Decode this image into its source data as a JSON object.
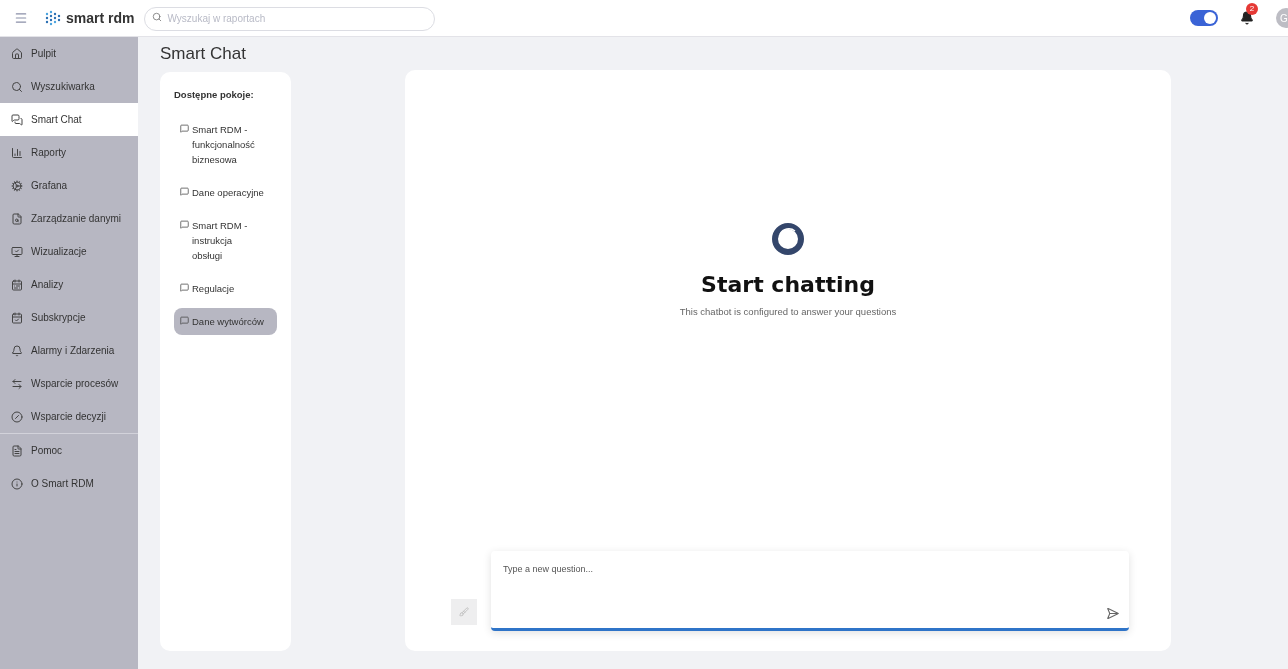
{
  "topbar": {
    "logo": "smart rdm",
    "search": {
      "placeholder": "Wyszukaj w raportach"
    },
    "theme_toggle": {
      "on": true
    },
    "notifications": {
      "badge": "2"
    },
    "avatar": "G"
  },
  "sidebar": {
    "items": [
      {
        "label": "Pulpit",
        "selected": false
      },
      {
        "label": "Wyszukiwarka",
        "selected": false
      },
      {
        "label": "Smart Chat",
        "selected": true
      },
      {
        "label": "Raporty",
        "selected": false
      },
      {
        "label": "Grafana",
        "selected": false
      },
      {
        "label": "Zarządzanie danymi",
        "selected": false
      },
      {
        "label": "Wizualizacje",
        "selected": false
      },
      {
        "label": "Analizy",
        "selected": false
      },
      {
        "label": "Subskrypcje",
        "selected": false
      },
      {
        "label": "Alarmy i Zdarzenia",
        "selected": false
      },
      {
        "label": "Wsparcie procesów",
        "selected": false
      },
      {
        "label": "Wsparcie decyzji",
        "selected": false
      }
    ],
    "bottom_items": [
      {
        "label": "Pomoc",
        "selected": false
      },
      {
        "label": "O Smart RDM",
        "selected": false
      }
    ]
  },
  "page_title": "Smart Chat",
  "rooms": {
    "title": "Dostępne pokoje:",
    "items": [
      {
        "label": "Smart RDM - funkcjonalność biznesowa",
        "selected": false
      },
      {
        "label": "Dane operacyjne",
        "selected": false
      },
      {
        "label": "Smart RDM - instrukcja obsługi",
        "selected": false
      },
      {
        "label": "Regulacje",
        "selected": false
      },
      {
        "label": "Dane wytwórców",
        "selected": true
      }
    ]
  },
  "chat": {
    "heading": "Start chatting",
    "subtitle": "This chatbot is configured to answer your questions",
    "input": {
      "placeholder": "Type a new question..."
    }
  }
}
